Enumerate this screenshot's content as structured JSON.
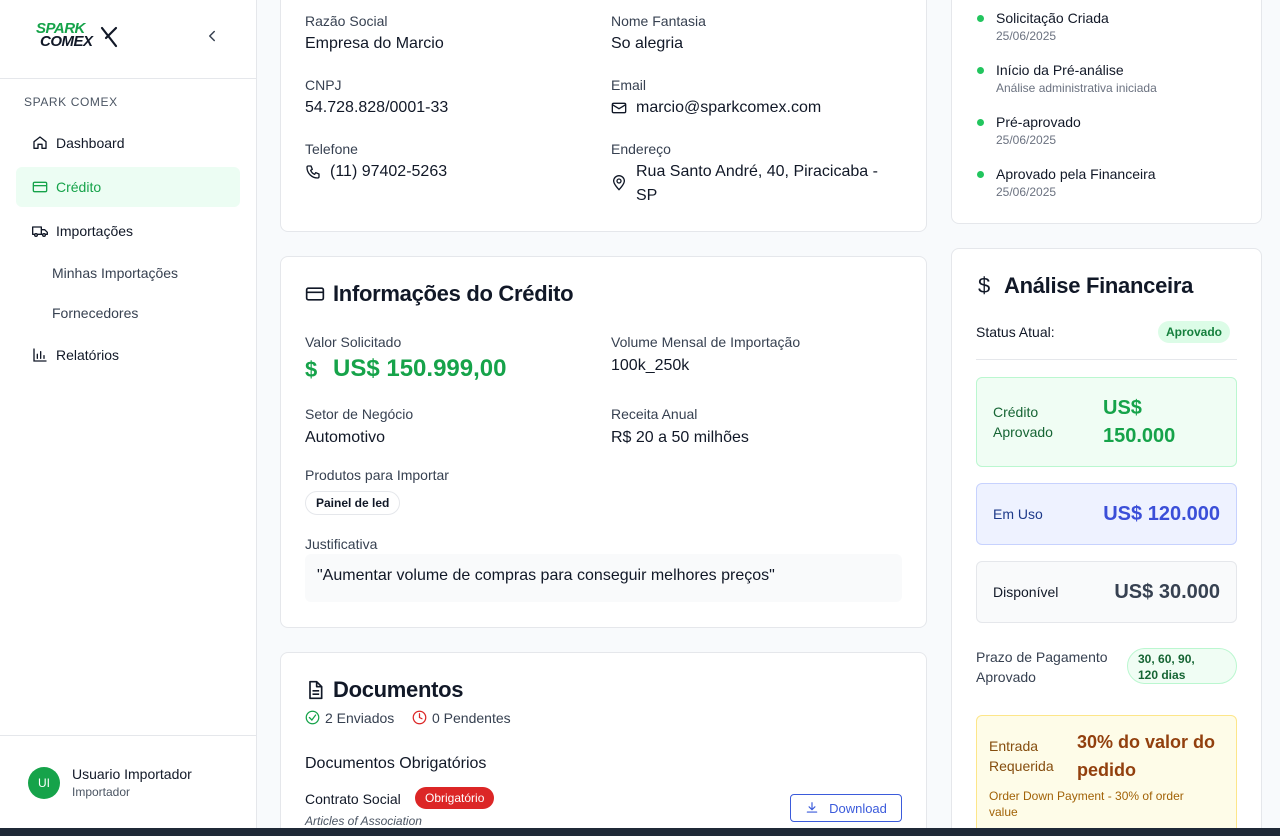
{
  "sidebar": {
    "logo_line1": "SPARK",
    "logo_line2": "COMEX",
    "section_label": "SPARK COMEX",
    "items": [
      {
        "label": "Dashboard"
      },
      {
        "label": "Crédito"
      },
      {
        "label": "Importações"
      },
      {
        "label": "Minhas Importações"
      },
      {
        "label": "Fornecedores"
      },
      {
        "label": "Relatórios"
      }
    ],
    "user": {
      "initials": "UI",
      "name": "Usuario Importador",
      "role": "Importador"
    }
  },
  "company": {
    "razao_social_label": "Razão Social",
    "razao_social": "Empresa do Marcio",
    "nome_fantasia_label": "Nome Fantasia",
    "nome_fantasia": "So alegria",
    "cnpj_label": "CNPJ",
    "cnpj": "54.728.828/0001-33",
    "email_label": "Email",
    "email": "marcio@sparkcomex.com",
    "telefone_label": "Telefone",
    "telefone": "(11) 97402-5263",
    "endereco_label": "Endereço",
    "endereco_line1": "Rua Santo André, 40, Piracicaba -",
    "endereco_line2": "SP"
  },
  "credit": {
    "title": "Informações do Crédito",
    "valor_label": "Valor Solicitado",
    "valor": "US$ 150.999,00",
    "volume_label": "Volume Mensal de Importação",
    "volume": "100k_250k",
    "setor_label": "Setor de Negócio",
    "setor": "Automotivo",
    "receita_label": "Receita Anual",
    "receita": "R$ 20 a 50 milhões",
    "produtos_label": "Produtos para Importar",
    "produtos": [
      "Painel de led"
    ],
    "justificativa_label": "Justificativa",
    "justificativa": "\"Aumentar volume de compras para conseguir melhores preços\""
  },
  "documents": {
    "title": "Documentos",
    "enviados": "2 Enviados",
    "pendentes": "0 Pendentes",
    "section_title": "Documentos Obrigatórios",
    "items": [
      {
        "name": "Contrato Social",
        "badge": "Obrigatório",
        "subtitle": "Articles of Association",
        "action": "Download"
      }
    ]
  },
  "timeline": [
    {
      "title": "Solicitação Criada",
      "sub": "25/06/2025"
    },
    {
      "title": "Início da Pré-análise",
      "sub": "Análise administrativa iniciada"
    },
    {
      "title": "Pré-aprovado",
      "sub": "25/06/2025"
    },
    {
      "title": "Aprovado pela Financeira",
      "sub": "25/06/2025"
    }
  ],
  "financial": {
    "title": "Análise Financeira",
    "status_label": "Status Atual:",
    "status": "Aprovado",
    "aprovado_label_1": "Crédito",
    "aprovado_label_2": "Aprovado",
    "aprovado_value_1": "US$",
    "aprovado_value_2": "150.000",
    "em_uso_label": "Em Uso",
    "em_uso_value": "US$ 120.000",
    "disponivel_label": "Disponível",
    "disponivel_value": "US$ 30.000",
    "prazo_label_1": "Prazo de Pagamento",
    "prazo_label_2": "Aprovado",
    "prazo_value_1": "30, 60, 90,",
    "prazo_value_2": "120 dias",
    "entrada_label_1": "Entrada",
    "entrada_label_2": "Requerida",
    "entrada_value_1": "30% do valor do",
    "entrada_value_2": "pedido",
    "entrada_note_1": "Order Down Payment - 30% of order",
    "entrada_note_2": "value"
  },
  "colors": {
    "accent": "#16a34a",
    "blue": "#3b5bdb",
    "danger": "#dc2626",
    "warning": "#92400e"
  }
}
